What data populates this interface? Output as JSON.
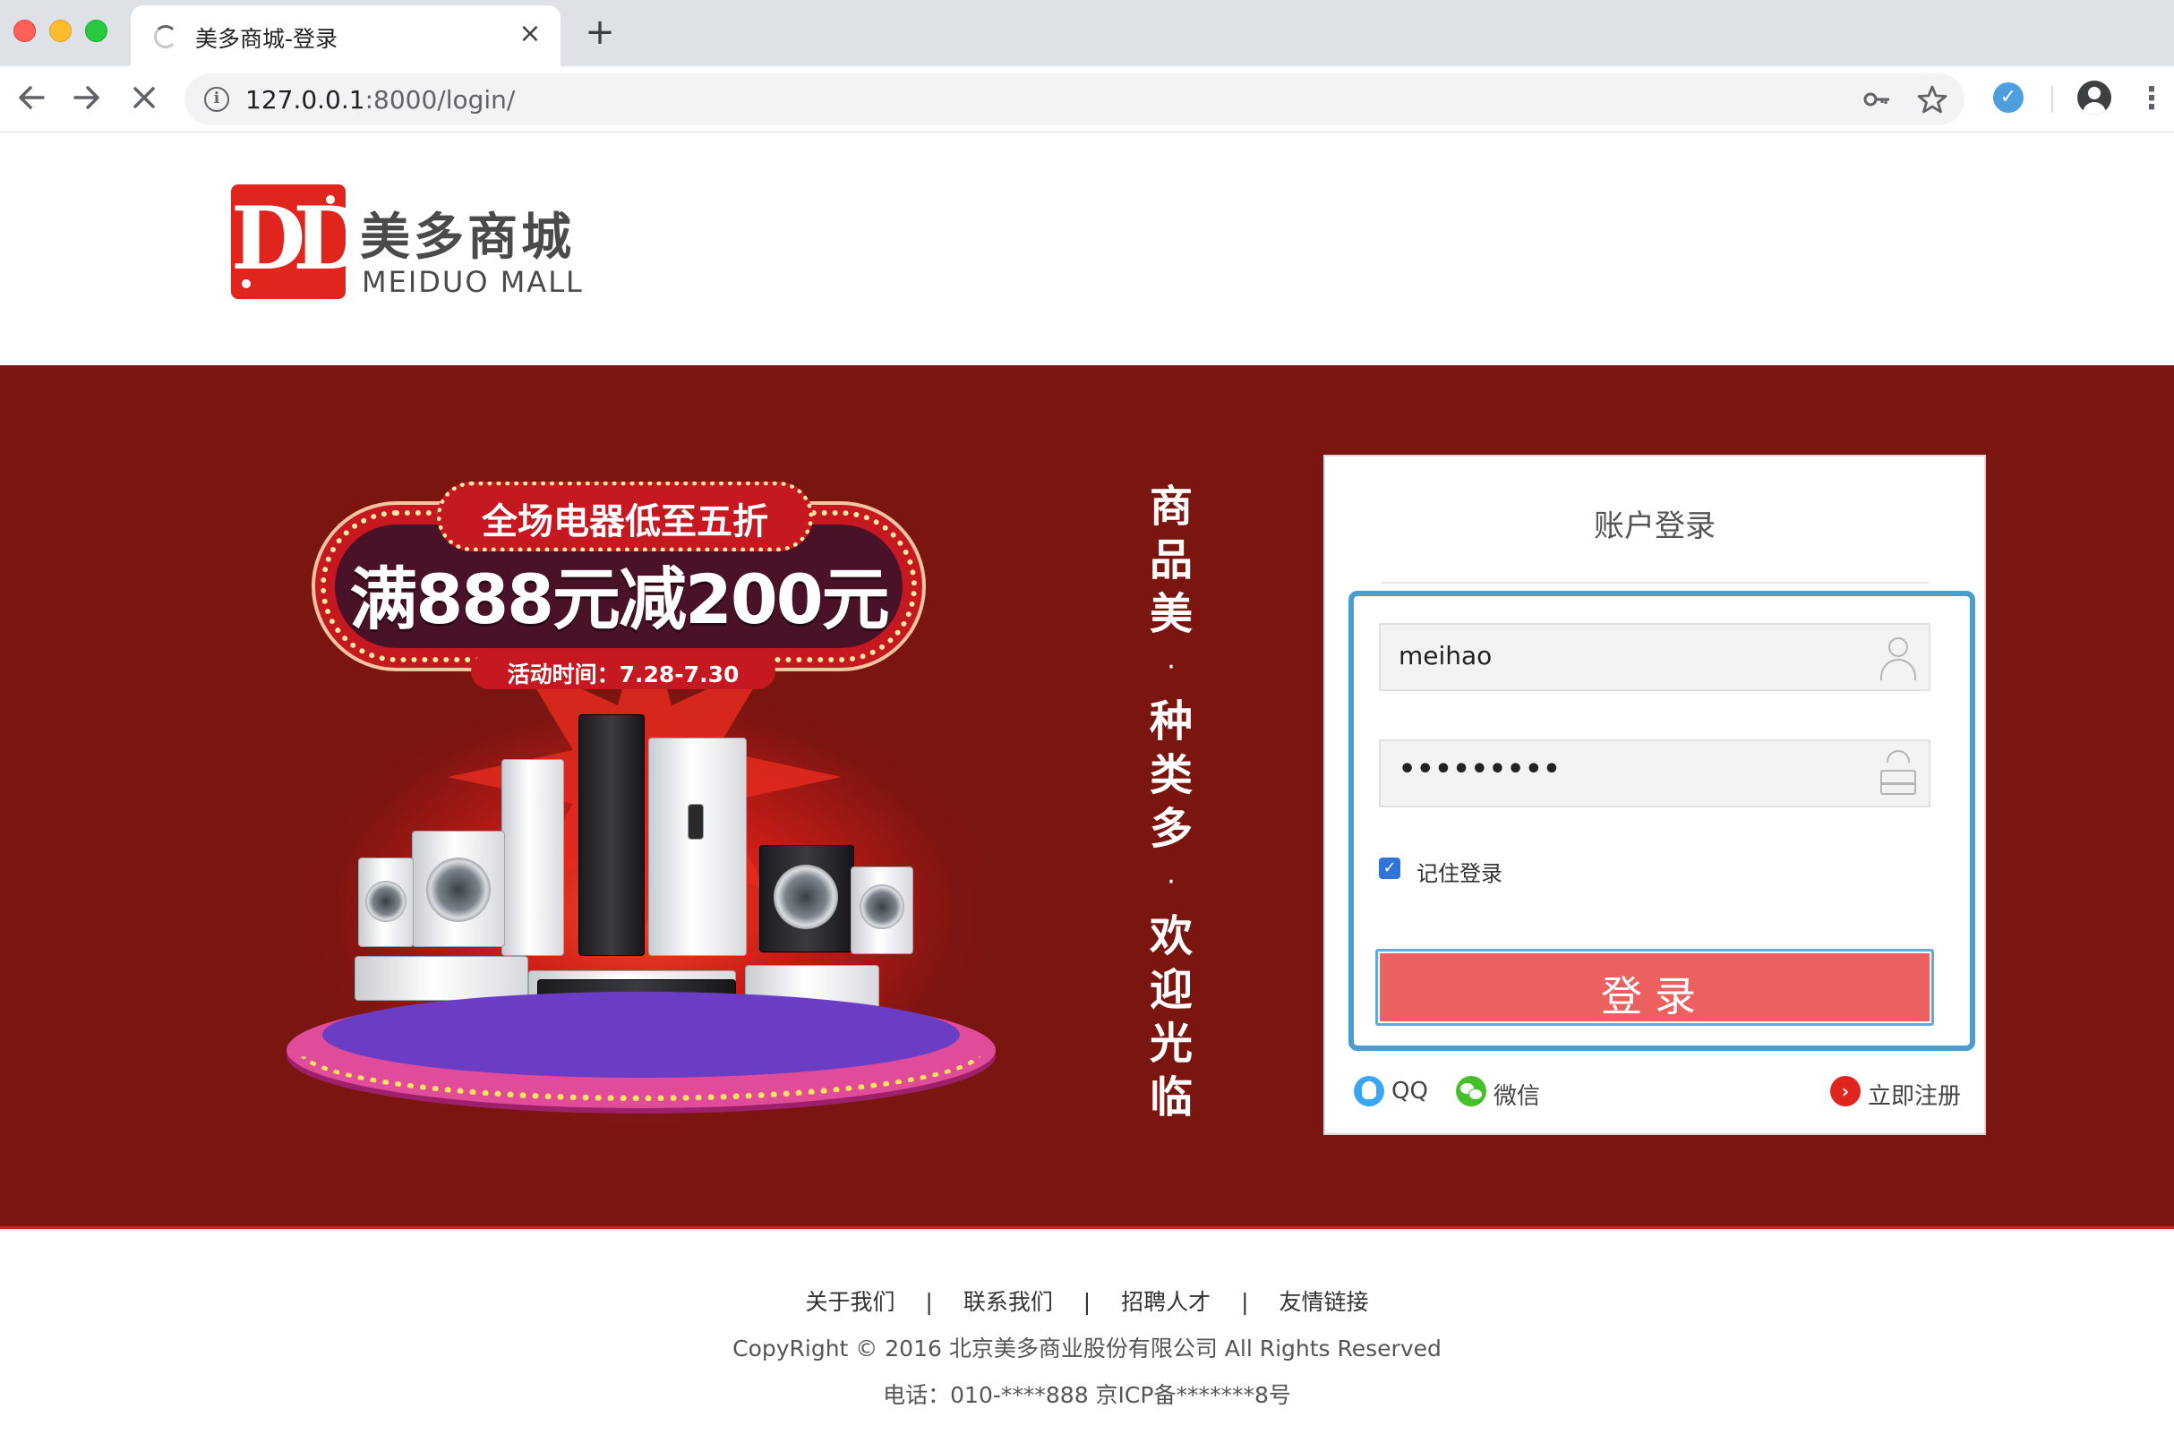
{
  "browser": {
    "tab_title": "美多商城-登录",
    "url_host": "127.0.0.1",
    "url_path": ":8000/login/",
    "new_tab_label": "+",
    "close_tab_label": "×"
  },
  "header": {
    "logo_letters": "DD",
    "logo_cn": "美多商城",
    "logo_en": "MEIDUO MALL"
  },
  "promo": {
    "top_text": "全场电器低至五折",
    "main_text": "满888元减200元",
    "date_text": "活动时间：7.28-7.30"
  },
  "slogan": {
    "chars": [
      "商",
      "品",
      "美",
      "·",
      "种",
      "类",
      "多",
      "·",
      "欢",
      "迎",
      "光",
      "临"
    ]
  },
  "login": {
    "title": "账户登录",
    "username_value": "meihao",
    "password_value": "•••••••••",
    "remember_label": "记住登录",
    "remember_checked": true,
    "submit_label": "登录",
    "qq_label": "QQ",
    "wechat_label": "微信",
    "register_label": "立即注册"
  },
  "footer": {
    "links": [
      "关于我们",
      "联系我们",
      "招聘人才",
      "友情链接"
    ],
    "separator": "|",
    "copyright": "CopyRight © 2016 北京美多商业股份有限公司 All Rights Reserved",
    "phone": "电话：010-****888 京ICP备*******8号"
  },
  "colors": {
    "brand_red": "#e0251e",
    "banner_bg": "#7a1510",
    "button_red": "#ec6060",
    "focus_blue": "#4a9ecf"
  },
  "icons": {
    "back": "arrow-left-icon",
    "forward": "arrow-right-icon",
    "stop": "close-icon",
    "site_info": "info-icon",
    "password_key": "key-icon",
    "bookmark": "star-icon",
    "extension": "extension-icon",
    "profile": "account-circle-icon",
    "menu": "kebab-menu-icon",
    "username": "user-icon",
    "password": "lock-icon"
  }
}
